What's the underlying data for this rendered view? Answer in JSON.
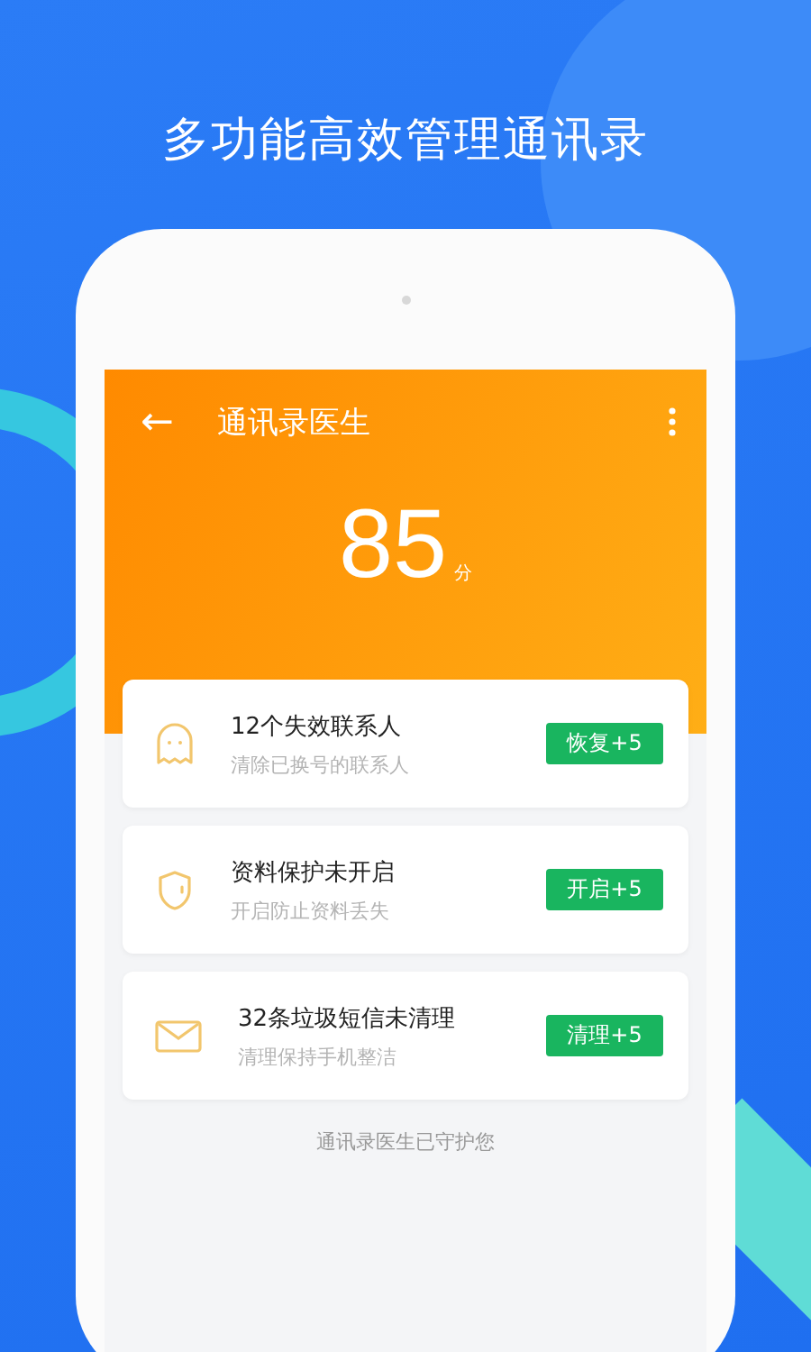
{
  "headline": "多功能高效管理通讯录",
  "app_bar": {
    "back": "←",
    "title": "通讯录医生"
  },
  "score": {
    "value": "85",
    "unit": "分"
  },
  "items": [
    {
      "kind": "ghost",
      "title": "12个失效联系人",
      "subtitle": "清除已换号的联系人",
      "action": "恢复+5"
    },
    {
      "kind": "shield",
      "title": "资料保护未开启",
      "subtitle": "开启防止资料丢失",
      "action": "开启+5"
    },
    {
      "kind": "mail",
      "title": "32条垃圾短信未清理",
      "subtitle": "清理保持手机整洁",
      "action": "清理+5"
    }
  ],
  "footer": "通讯录医生已守护您"
}
